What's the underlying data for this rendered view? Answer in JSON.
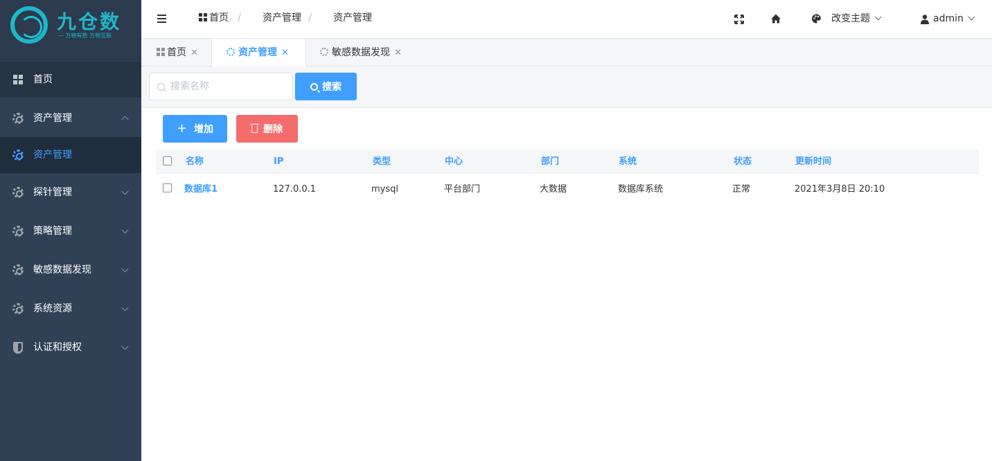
{
  "logo": {
    "name": "九仓数",
    "slogan": "— 万物有数 万物互联"
  },
  "sidebar": {
    "items": [
      {
        "label": "首页",
        "icon": "dashboard-icon"
      },
      {
        "label": "资产管理",
        "icon": "gear-icon",
        "expanded": true
      },
      {
        "label": "资产管理",
        "icon": "gear-icon",
        "active": true
      },
      {
        "label": "探针管理",
        "icon": "gear-icon"
      },
      {
        "label": "策略管理",
        "icon": "gear-icon"
      },
      {
        "label": "敏感数据发现",
        "icon": "gear-icon"
      },
      {
        "label": "系统资源",
        "icon": "gear-icon"
      },
      {
        "label": "认证和授权",
        "icon": "shield-icon"
      }
    ]
  },
  "header": {
    "breadcrumb": [
      "首页",
      "资产管理",
      "资产管理"
    ],
    "theme_label": "改变主题",
    "user": "admin"
  },
  "tabs": [
    {
      "label": "首页"
    },
    {
      "label": "资产管理",
      "active": true
    },
    {
      "label": "敏感数据发现"
    }
  ],
  "search": {
    "placeholder": "搜索名称",
    "value": "",
    "button": "搜索"
  },
  "toolbar": {
    "add_label": "增加",
    "delete_label": "删除"
  },
  "table": {
    "columns": [
      "名称",
      "IP",
      "类型",
      "中心",
      "部门",
      "系统",
      "状态",
      "更新时间"
    ],
    "rows": [
      [
        "数据库1",
        "127.0.0.1",
        "mysql",
        "平台部门",
        "大数据",
        "数据库系统",
        "正常",
        "2021年3月8日 20:10"
      ]
    ]
  },
  "colors": {
    "sidebar_bg": "#304156",
    "accent": "#409eff",
    "danger": "#f56c6c",
    "brand": "#1fb6c9"
  }
}
